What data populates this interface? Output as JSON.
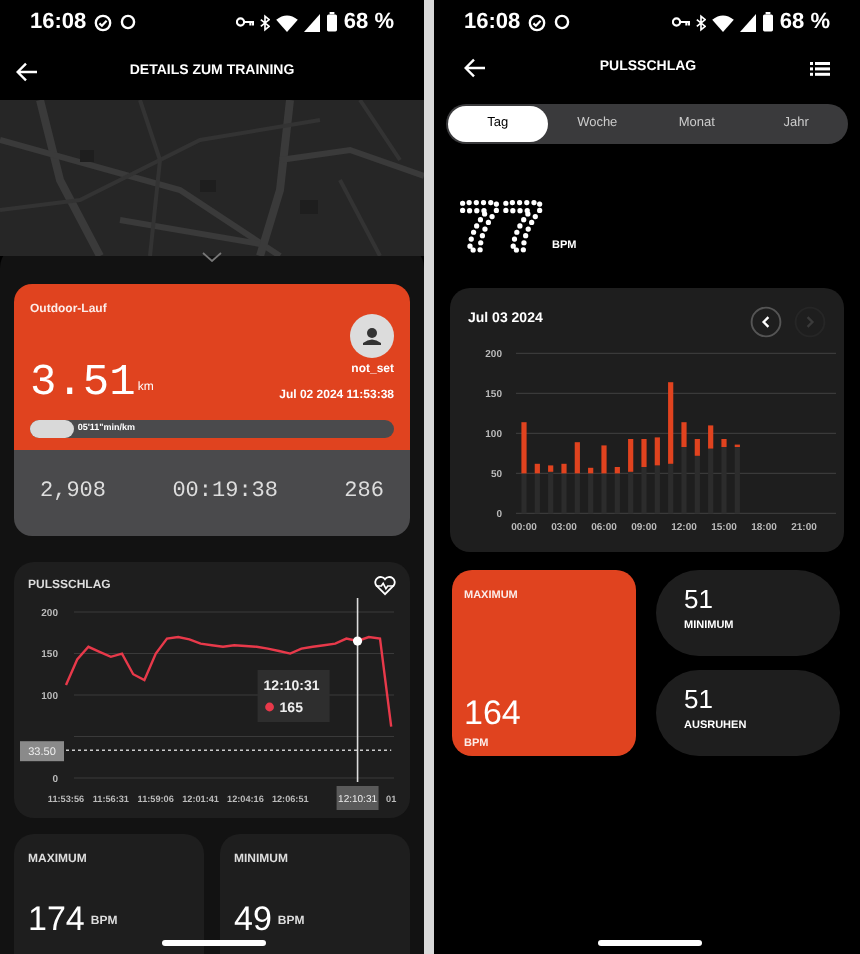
{
  "left_screen": {
    "status_bar": {
      "time": "16:08",
      "battery": "68 %"
    },
    "header": {
      "title": "DETAILS ZUM TRAINING"
    },
    "workout_card": {
      "type": "Outdoor-Lauf",
      "distance": "3.51",
      "unit": "km",
      "user": "not_set",
      "datetime": "Jul 02 2024 11:53:38",
      "pace": {
        "label": "05'11\"min/km",
        "level": 0.12
      },
      "stats": [
        "2,908",
        "00:19:38",
        "286"
      ]
    },
    "heart_rate_card": {
      "title": "PULSSCHLAG",
      "reference_label": "33.50",
      "cursor_label": "12:10:31",
      "tooltip": {
        "time": "12:10:31",
        "value": "165"
      },
      "chart_data": {
        "type": "line",
        "ylim": [
          0,
          200
        ],
        "yticks": [
          0,
          100,
          150,
          200
        ],
        "categories": [
          "11:53:56",
          null,
          null,
          null,
          "11:56:31",
          null,
          null,
          null,
          "11:59:06",
          null,
          null,
          null,
          "12:01:41",
          null,
          null,
          null,
          "12:04:16",
          null,
          null,
          null,
          "12:06:51",
          null,
          null,
          null,
          null,
          null,
          null,
          null,
          null,
          "01"
        ],
        "series": [
          {
            "color": "#e8394a",
            "values": [
              112,
              143,
              158,
              152,
              146,
              150,
              125,
              118,
              150,
              168,
              170,
              167,
              162,
              160,
              158,
              160,
              159,
              158,
              156,
              153,
              150,
              156,
              158,
              160,
              162,
              168,
              165,
              170,
              168,
              62
            ]
          },
          {
            "color": "#cccccc",
            "line_style": "dashed",
            "values": [
              33.5,
              33.5,
              33.5,
              33.5,
              33.5,
              33.5,
              33.5,
              33.5,
              33.5,
              33.5,
              33.5,
              33.5,
              33.5,
              33.5,
              33.5,
              33.5,
              33.5,
              33.5,
              33.5,
              33.5,
              33.5,
              33.5,
              33.5,
              33.5,
              33.5,
              33.5,
              33.5,
              33.5,
              33.5,
              33.5
            ]
          }
        ],
        "grid": true
      }
    },
    "summary": [
      {
        "label": "MAXIMUM",
        "value": "174",
        "unit": "BPM"
      },
      {
        "label": "MINIMUM",
        "value": "49",
        "unit": "BPM"
      }
    ]
  },
  "right_screen": {
    "status_bar": {
      "time": "16:08",
      "battery": "68 %"
    },
    "header": {
      "title": "PULSSCHLAG"
    },
    "tabs": [
      {
        "label": "Tag",
        "selected": true
      },
      {
        "label": "Woche",
        "selected": false
      },
      {
        "label": "Monat",
        "selected": false
      },
      {
        "label": "Jahr",
        "selected": false
      }
    ],
    "current": {
      "value": "77",
      "unit": "BPM"
    },
    "chart_card": {
      "date": "Jul 03 2024",
      "nav_buttons": [
        {
          "kind": "previous",
          "disabled": false
        },
        {
          "kind": "next",
          "disabled": true
        }
      ],
      "chart_data": {
        "type": "bar",
        "stacked": true,
        "grid": true,
        "xlim": [
          -0.6,
          23.4
        ],
        "ylim": [
          0,
          200
        ],
        "yticks": [
          0,
          50,
          100,
          150,
          200
        ],
        "xticks": [
          {
            "value": 0,
            "label": "00:00"
          },
          {
            "value": 3,
            "label": "03:00"
          },
          {
            "value": 6,
            "label": "06:00"
          },
          {
            "value": 9,
            "label": "09:00"
          },
          {
            "value": 12,
            "label": "12:00"
          },
          {
            "value": 15,
            "label": "15:00"
          },
          {
            "value": 18,
            "label": "18:00"
          },
          {
            "value": 21,
            "label": "21:00"
          }
        ],
        "x": [
          0,
          1,
          2,
          3,
          4,
          5,
          6,
          7,
          8,
          9,
          10,
          11,
          12,
          13,
          14,
          15,
          16
        ],
        "series": [
          {
            "color": "#2c2c2c",
            "values": [
              50,
              50,
              52,
              50,
              50,
              50,
              50,
              50,
              52,
              58,
              60,
              62,
              83,
              72,
              81,
              83,
              83
            ]
          },
          {
            "color": "#e0431f",
            "values": [
              64,
              12,
              8,
              12,
              39,
              7,
              35,
              8,
              41,
              35,
              35,
              102,
              31,
              21,
              29,
              10,
              3
            ]
          }
        ]
      }
    },
    "tiles": [
      {
        "kind": "large",
        "label": "MAXIMUM",
        "value": "164",
        "unit": "BPM"
      },
      {
        "kind": "pill",
        "label": "MINIMUM",
        "value": "51"
      },
      {
        "kind": "pill",
        "label": "AUSRUHEN",
        "value": "51"
      }
    ]
  }
}
